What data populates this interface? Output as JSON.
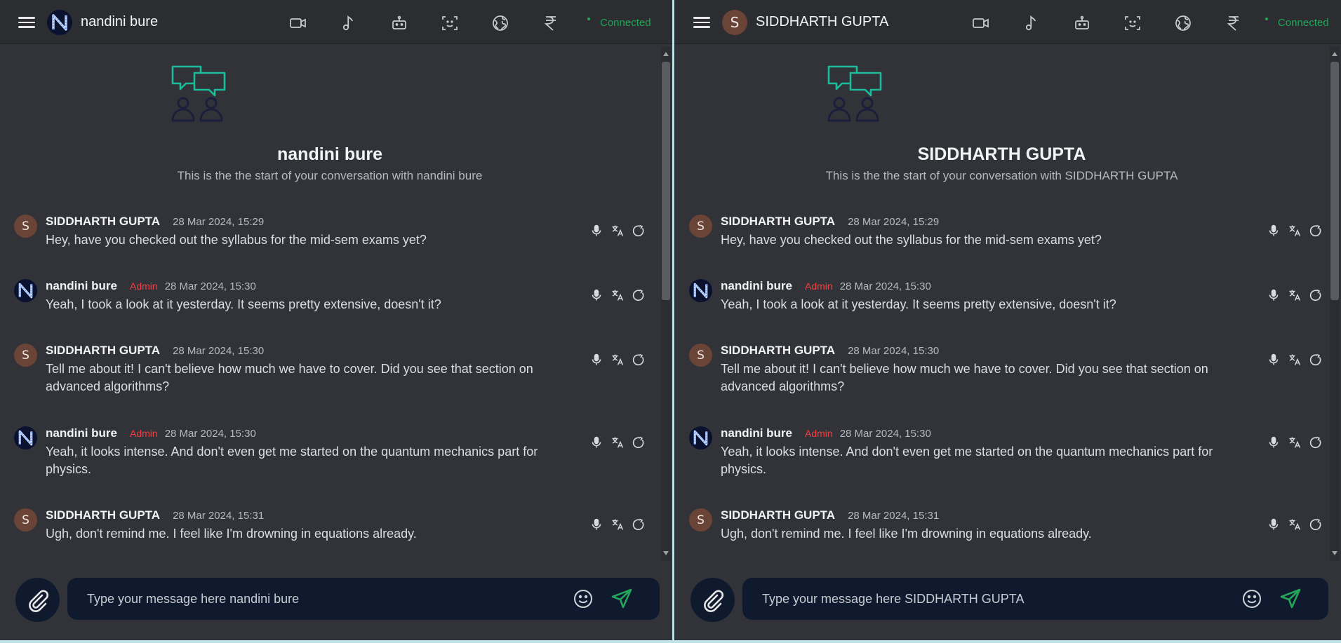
{
  "left": {
    "title": "nandini bure",
    "avatar_letter": "N",
    "status": "Connected",
    "welcome_title": "nandini bure",
    "welcome_sub": "This is the the start of your conversation with nandini bure",
    "placeholder": "Type your message here nandini bure"
  },
  "right": {
    "title": "SIDDHARTH GUPTA",
    "avatar_letter": "S",
    "status": "Connected",
    "welcome_title": "SIDDHARTH GUPTA",
    "welcome_sub": "This is the the start of your conversation with SIDDHARTH GUPTA",
    "placeholder": "Type your message here SIDDHARTH GUPTA"
  },
  "toolbar_icons": [
    "video-icon",
    "music-note-icon",
    "robot-icon",
    "face-scan-icon",
    "globe-icon",
    "rupee-icon"
  ],
  "message_action_icons": [
    "microphone-icon",
    "translate-icon",
    "refresh-icon"
  ],
  "messages": [
    {
      "author": "SIDDHARTH GUPTA",
      "avatar": "S",
      "badge": "",
      "time": "28 Mar 2024, 15:29",
      "text": "Hey, have you checked out the syllabus for the mid-sem exams yet?"
    },
    {
      "author": "nandini bure",
      "avatar": "N",
      "badge": "Admin",
      "time": "28 Mar 2024, 15:30",
      "text": "Yeah, I took a look at it yesterday. It seems pretty extensive, doesn't it?"
    },
    {
      "author": "SIDDHARTH GUPTA",
      "avatar": "S",
      "badge": "",
      "time": "28 Mar 2024, 15:30",
      "text": "Tell me about it! I can't believe how much we have to cover. Did you see that section on advanced algorithms?"
    },
    {
      "author": "nandini bure",
      "avatar": "N",
      "badge": "Admin",
      "time": "28 Mar 2024, 15:30",
      "text": "Yeah, it looks intense. And don't even get me started on the quantum mechanics part for physics."
    },
    {
      "author": "SIDDHARTH GUPTA",
      "avatar": "S",
      "badge": "",
      "time": "28 Mar 2024, 15:31",
      "text": "Ugh, don't remind me. I feel like I'm drowning in equations already."
    }
  ],
  "colors": {
    "background": "#313338",
    "header": "#2b2d31",
    "accent_green": "#23a55a",
    "admin_badge": "#f23f42",
    "composer": "#0f1a2e",
    "welcome_teal": "#1abc9c"
  }
}
